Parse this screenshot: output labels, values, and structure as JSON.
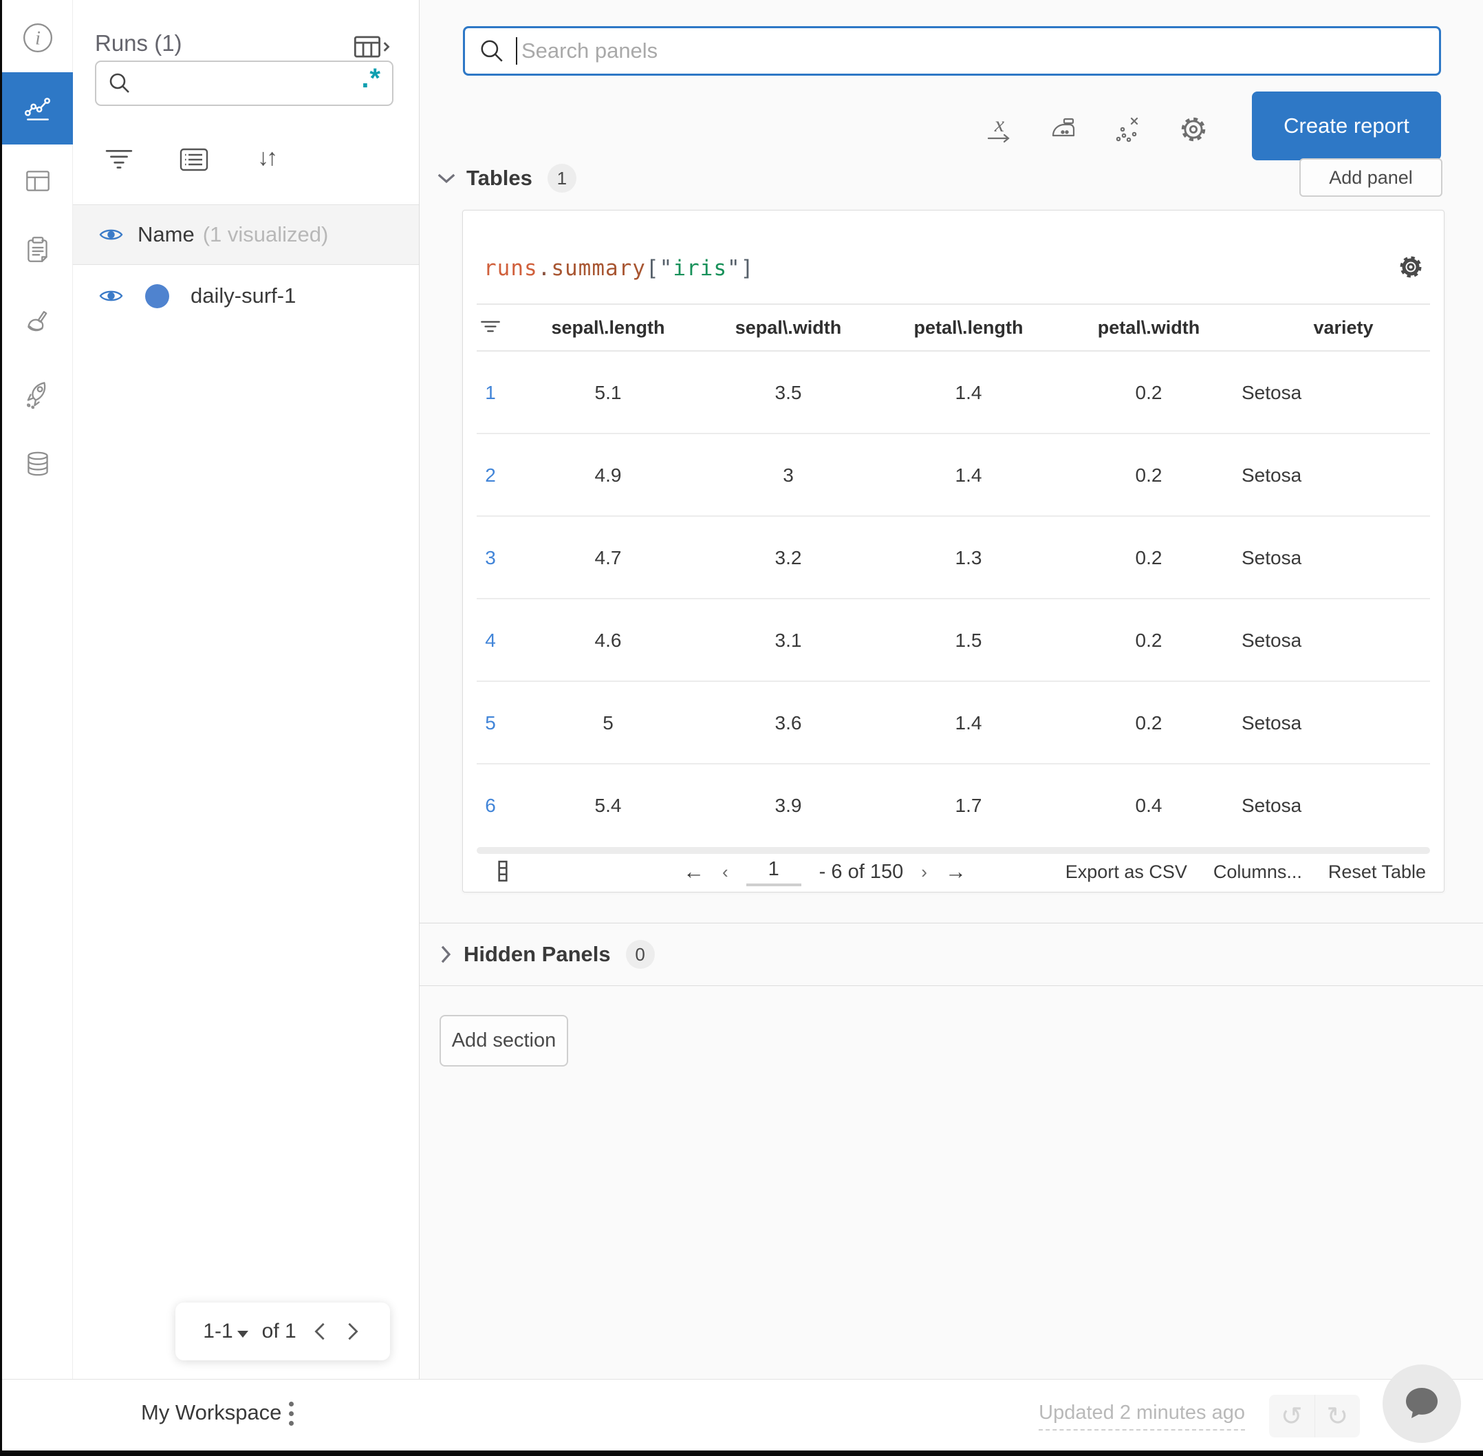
{
  "colors": {
    "accent": "#2e78c6",
    "teal": "#0e9fb0",
    "link_blue": "#4285d8",
    "run_dot": "#4f83cf",
    "eye_blue": "#3b7bc8"
  },
  "icon_rail": {
    "items": [
      "info-icon",
      "line-chart-icon",
      "table-layout-icon",
      "clipboard-icon",
      "broom-icon",
      "rocket-icon",
      "database-icon"
    ],
    "selected_index": 1
  },
  "runs_panel": {
    "title": "Runs (1)",
    "regex_toggle": ".*",
    "header": {
      "label": "Name",
      "sub": "(1 visualized)"
    },
    "runs": [
      {
        "name": "daily-surf-1",
        "dot_color": "#4f83cf"
      }
    ],
    "pagination": {
      "range": "1-1",
      "of_label": "of 1"
    }
  },
  "topbar": {
    "search_placeholder": "Search panels",
    "create_report_label": "Create report",
    "icons": [
      "x-axis-icon",
      "smoothing-iron-icon",
      "outliers-icon",
      "settings-gear-icon"
    ]
  },
  "sections": {
    "tables": {
      "label": "Tables",
      "count": "1"
    },
    "hidden": {
      "label": "Hidden Panels",
      "count": "0"
    },
    "add_panel_label": "Add panel",
    "add_section_label": "Add section"
  },
  "table_panel": {
    "title_tokens": [
      {
        "text": "runs",
        "color": "#d0603c"
      },
      {
        "text": ".",
        "color": "#8a5340"
      },
      {
        "text": "summary",
        "color": "#a85632"
      },
      {
        "text": "[",
        "color": "#56606a"
      },
      {
        "text": "\"",
        "color": "#56606a"
      },
      {
        "text": "iris",
        "color": "#18915a"
      },
      {
        "text": "\"",
        "color": "#56606a"
      },
      {
        "text": "]",
        "color": "#56606a"
      }
    ],
    "columns": [
      "sepal\\.length",
      "sepal\\.width",
      "petal\\.length",
      "petal\\.width",
      "variety"
    ],
    "rows": [
      {
        "index": "1",
        "values": [
          "5.1",
          "3.5",
          "1.4",
          "0.2",
          "Setosa"
        ]
      },
      {
        "index": "2",
        "values": [
          "4.9",
          "3",
          "1.4",
          "0.2",
          "Setosa"
        ]
      },
      {
        "index": "3",
        "values": [
          "4.7",
          "3.2",
          "1.3",
          "0.2",
          "Setosa"
        ]
      },
      {
        "index": "4",
        "values": [
          "4.6",
          "3.1",
          "1.5",
          "0.2",
          "Setosa"
        ]
      },
      {
        "index": "5",
        "values": [
          "5",
          "3.6",
          "1.4",
          "0.2",
          "Setosa"
        ]
      },
      {
        "index": "6",
        "values": [
          "5.4",
          "3.9",
          "1.7",
          "0.4",
          "Setosa"
        ]
      }
    ],
    "footer": {
      "page": "1",
      "range_label": "- 6 of 150",
      "export_label": "Export as CSV",
      "columns_label": "Columns...",
      "reset_label": "Reset Table"
    }
  },
  "bottom_bar": {
    "workspace_label": "My Workspace",
    "updated_label": "Updated 2 minutes ago"
  }
}
